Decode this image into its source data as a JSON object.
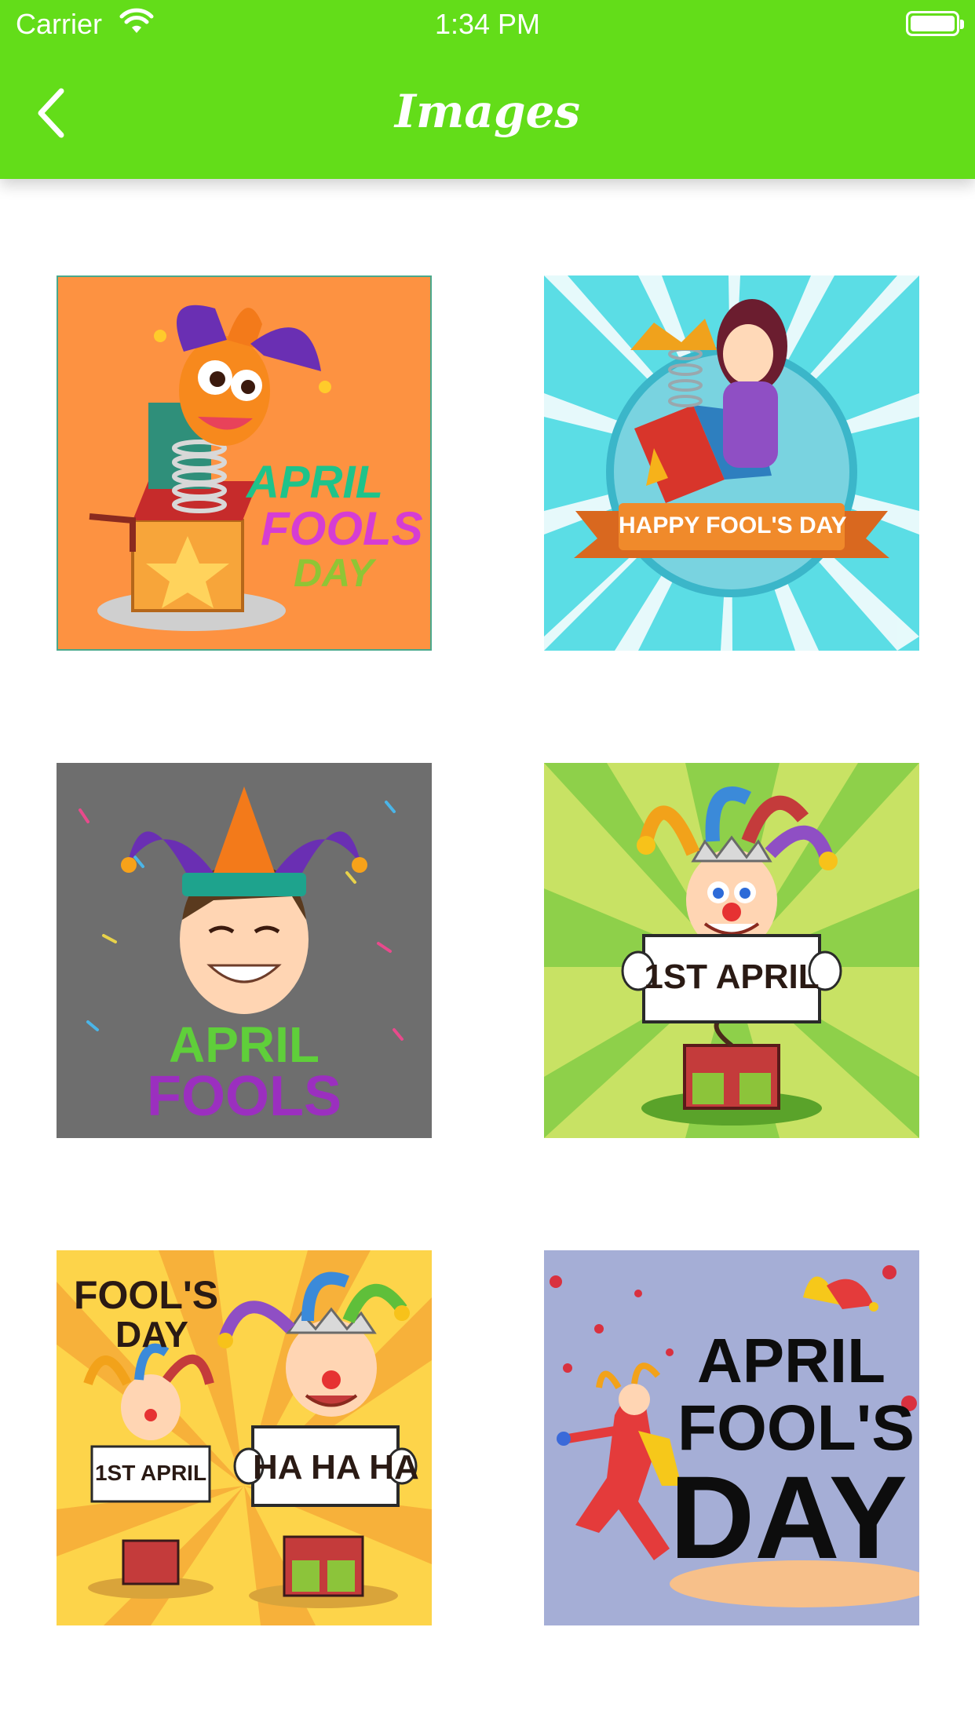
{
  "status_bar": {
    "carrier": "Carrier",
    "time": "1:34 PM"
  },
  "nav": {
    "title": "Images"
  },
  "gallery": [
    {
      "caption_lines": [
        "APRIL",
        "FOOLS",
        "DAY"
      ],
      "bg": "#fd9241"
    },
    {
      "caption_lines": [
        "HAPPY FOOL'S DAY"
      ],
      "bg": "#5bdde5"
    },
    {
      "caption_lines": [
        "APRIL",
        "FOOLS"
      ],
      "bg": "#6e6e6e"
    },
    {
      "caption_lines": [
        "1ST APRIL"
      ],
      "bg": "#c8e264"
    },
    {
      "caption_lines": [
        "FOOL'S",
        "DAY",
        "1ST APRIL",
        "HA HA HA"
      ],
      "bg": "#fdd44a"
    },
    {
      "caption_lines": [
        "APRIL",
        "FOOL'S",
        "DAY"
      ],
      "bg": "#a5aed6"
    }
  ],
  "colors": {
    "nav_green": "#63dd19",
    "background": "#ffffff"
  }
}
